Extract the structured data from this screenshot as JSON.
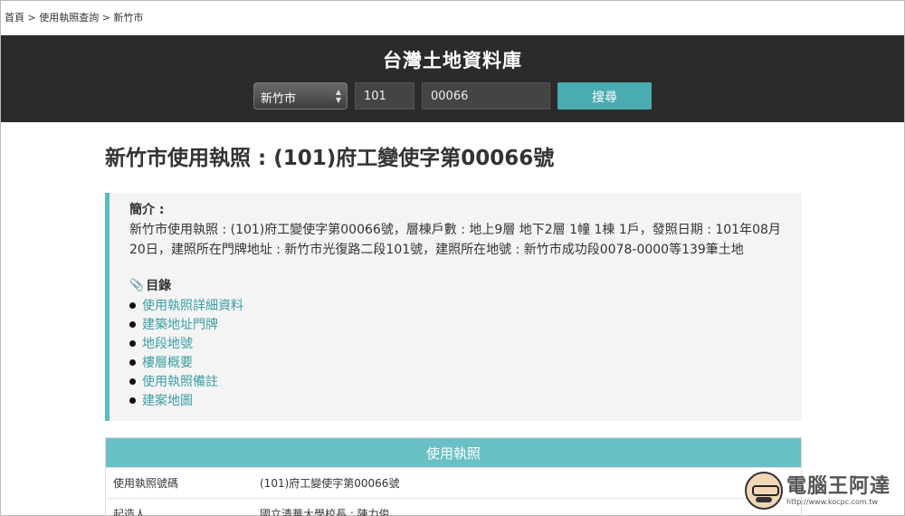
{
  "breadcrumb": {
    "text": "首頁 > 使用執照查詢 > 新竹市"
  },
  "header": {
    "site_title": "台灣土地資料庫",
    "search": {
      "city": "新竹市",
      "year": "101",
      "number": "00066",
      "button": "搜尋"
    }
  },
  "page_title": "新竹市使用執照 : (101)府工變使字第00066號",
  "intro": {
    "heading": "簡介 :",
    "text": "新竹市使用執照 : (101)府工變使字第00066號，層棟戶數 : 地上9層 地下2層 1幢 1棟 1戶，發照日期 : 101年08月20日，建照所在門牌地址 : 新竹市光復路二段101號，建照所在地號 : 新竹市成功段0078-0000等139筆土地"
  },
  "toc": {
    "heading": "目錄",
    "items": [
      "使用執照詳細資料",
      "建築地址門牌",
      "地段地號",
      "樓層概要",
      "使用執照備註",
      "建案地圖"
    ]
  },
  "permit_table": {
    "title": "使用執照",
    "rows": [
      {
        "label": "使用執照號碼",
        "value": "(101)府工變使字第00066號"
      },
      {
        "label": "起造人",
        "value": "國立清華大學校長 : 陳力俊"
      }
    ]
  },
  "watermark": {
    "title": "電腦王阿達",
    "url": "http://www.kocpc.com.tw"
  },
  "colors": {
    "accent": "#4aacb1",
    "banner": "#2b2b2b",
    "link": "#3a9fa5"
  }
}
